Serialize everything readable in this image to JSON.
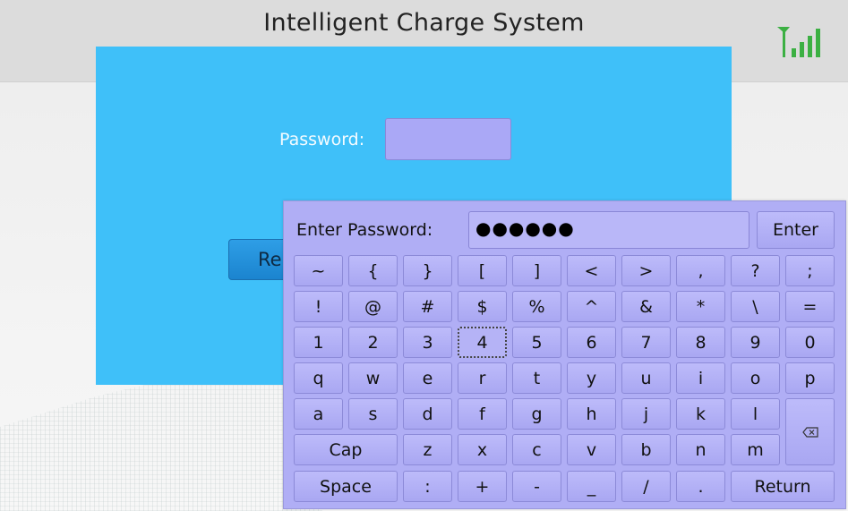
{
  "header": {
    "title": "Intelligent Charge System",
    "signal_icon": "signal-strength-icon"
  },
  "login": {
    "password_label": "Password:",
    "password_value": "",
    "button_label": "Re"
  },
  "keyboard": {
    "prompt": "Enter Password:",
    "field_value": "●●●●●●",
    "enter_label": "Enter",
    "rows": [
      [
        "~",
        "{",
        "}",
        "[",
        "]",
        "<",
        ">",
        ",",
        "?",
        ";"
      ],
      [
        "!",
        "@",
        "#",
        "$",
        "%",
        "^",
        "&",
        "*",
        "\\",
        "="
      ],
      [
        "1",
        "2",
        "3",
        "4",
        "5",
        "6",
        "7",
        "8",
        "9",
        "0"
      ],
      [
        "q",
        "w",
        "e",
        "r",
        "t",
        "y",
        "u",
        "i",
        "o",
        "p"
      ],
      [
        "a",
        "s",
        "d",
        "f",
        "g",
        "h",
        "j",
        "k",
        "l"
      ],
      [
        "Cap",
        "z",
        "x",
        "c",
        "v",
        "b",
        "n",
        "m"
      ],
      [
        "Space",
        ":",
        "+",
        "-",
        "_",
        "/",
        ".",
        "Return"
      ]
    ],
    "backspace_icon": "backspace-icon",
    "focused_key": "4"
  },
  "colors": {
    "panel": "#3fc0f9",
    "keyboard": "#b0aef5",
    "signal": "#3cb043"
  }
}
